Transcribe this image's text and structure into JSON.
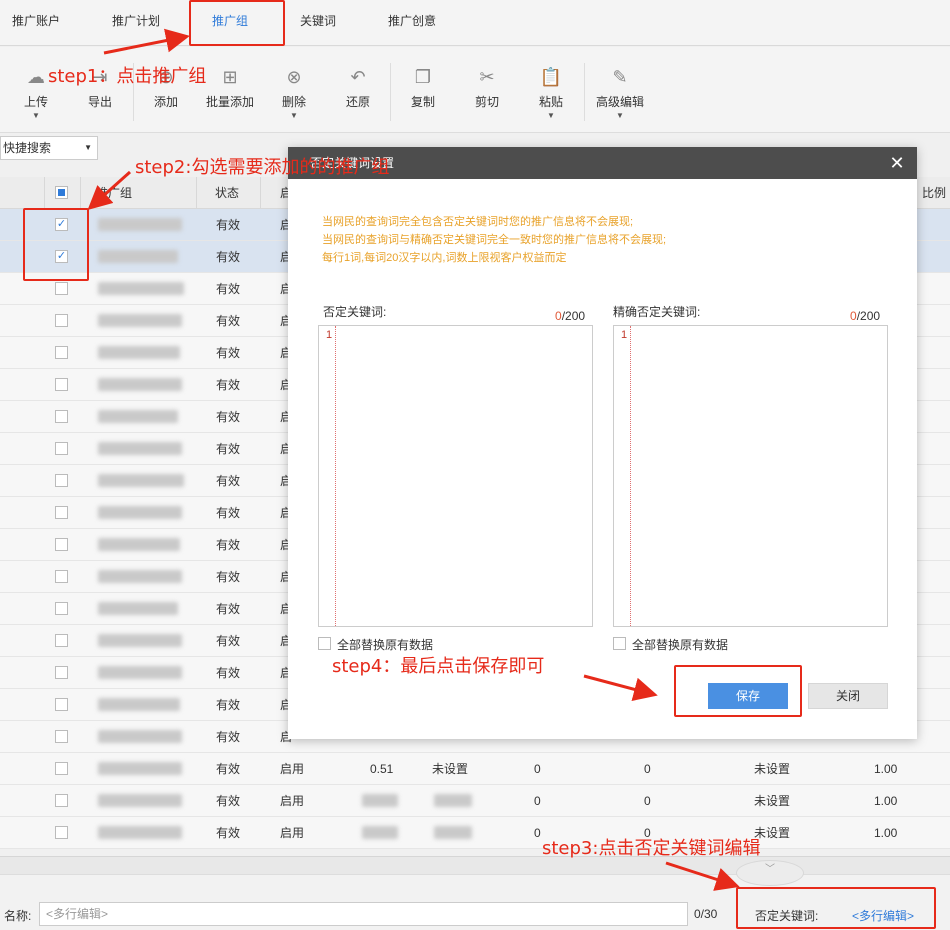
{
  "tabs": [
    {
      "label": "推广账户"
    },
    {
      "label": "推广计划"
    },
    {
      "label": "推广组"
    },
    {
      "label": "关键词"
    },
    {
      "label": "推广创意"
    }
  ],
  "toolbar": {
    "upload": "上传",
    "export": "导出",
    "add": "添加",
    "batch_add": "批量添加",
    "delete": "删除",
    "restore": "还原",
    "copy": "复制",
    "cut": "剪切",
    "paste": "粘贴",
    "advanced_edit": "高级编辑"
  },
  "quick_search": "快捷搜索",
  "table": {
    "headers": {
      "group": "推广组",
      "status": "状态",
      "enable": "启",
      "ratio": "比例"
    },
    "rows": [
      {
        "status": "有效",
        "enable": "启",
        "checked": true
      },
      {
        "status": "有效",
        "enable": "启",
        "checked": true
      },
      {
        "status": "有效",
        "enable": "启",
        "checked": false
      },
      {
        "status": "有效",
        "enable": "启",
        "checked": false
      },
      {
        "status": "有效",
        "enable": "启",
        "checked": false
      },
      {
        "status": "有效",
        "enable": "启",
        "checked": false
      },
      {
        "status": "有效",
        "enable": "启",
        "checked": false
      },
      {
        "status": "有效",
        "enable": "启",
        "checked": false
      },
      {
        "status": "有效",
        "enable": "启",
        "checked": false
      },
      {
        "status": "有效",
        "enable": "启",
        "checked": false
      },
      {
        "status": "有效",
        "enable": "启",
        "checked": false
      },
      {
        "status": "有效",
        "enable": "启",
        "checked": false
      },
      {
        "status": "有效",
        "enable": "启",
        "checked": false
      },
      {
        "status": "有效",
        "enable": "启",
        "checked": false
      },
      {
        "status": "有效",
        "enable": "启",
        "checked": false
      },
      {
        "status": "有效",
        "enable": "启",
        "checked": false
      },
      {
        "status": "有效",
        "enable": "启",
        "checked": false
      },
      {
        "status": "有效",
        "enable": "启用",
        "checked": false,
        "bid": "0.51",
        "neg": "未设置",
        "v1": "0",
        "v2": "0",
        "neg2": "未设置",
        "ratio": "1.00"
      },
      {
        "status": "有效",
        "enable": "启用",
        "checked": false,
        "v1": "0",
        "v2": "0",
        "neg2": "未设置",
        "ratio": "1.00"
      },
      {
        "status": "有效",
        "enable": "启用",
        "checked": false,
        "v1": "0",
        "v2": "0",
        "neg2": "未设置",
        "ratio": "1.00"
      }
    ]
  },
  "bottom": {
    "name_label": "名称:",
    "name_placeholder": "<多行编辑>",
    "name_count": "0/30",
    "neg_label": "否定关键词:",
    "neg_link": "<多行编辑>"
  },
  "dialog": {
    "title": "否定关键词设置",
    "notes": [
      "当网民的查询词完全包含否定关键词时您的推广信息将不会展现;",
      "当网民的查询词与精确否定关键词完全一致时您的推广信息将不会展现;",
      "每行1词,每词20汉字以内,词数上限视客户权益而定"
    ],
    "neg_label": "否定关键词:",
    "neg_count": "0",
    "neg_max": "/200",
    "exact_label": "精确否定关键词:",
    "exact_count": "0",
    "exact_max": "/200",
    "line_no": "1",
    "replace_label": "全部替换原有数据",
    "save": "保存",
    "close": "关闭"
  },
  "annotations": {
    "step1": "step1：点击推广组",
    "step2": "step2:勾选需要添加的的推广组",
    "step3": "step3:点击否定关键词编辑",
    "step4": "step4：最后点击保存即可"
  },
  "colors": {
    "accent": "#2f7bd9",
    "annotation": "#e62a1a",
    "note": "#e8a22a",
    "save_button": "#4a90e2"
  }
}
